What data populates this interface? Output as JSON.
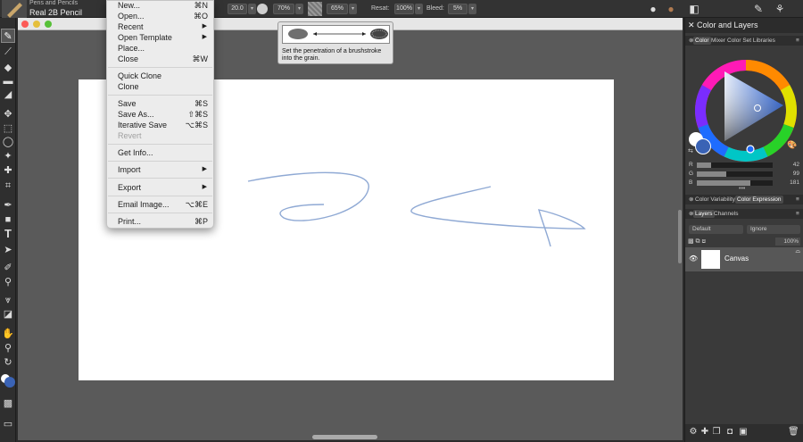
{
  "property_bar": {
    "brush_category": "Pens and Pencils",
    "brush_variant": "Real 2B Pencil",
    "size_value": "20.0",
    "opacity_value": "70%",
    "grain_value": "65%",
    "resat_label": "Resat:",
    "resat_value": "100%",
    "bleed_label": "Bleed:",
    "bleed_value": "5%"
  },
  "file_menu": {
    "items": [
      {
        "label": "New...",
        "shortcut": "⌘N"
      },
      {
        "label": "Open...",
        "shortcut": "⌘O"
      },
      {
        "label": "Recent",
        "submenu": true
      },
      {
        "label": "Open Template",
        "submenu": true
      },
      {
        "label": "Place..."
      },
      {
        "label": "Close",
        "shortcut": "⌘W"
      },
      {
        "label": "Quick Clone"
      },
      {
        "label": "Clone"
      },
      {
        "label": "Save",
        "shortcut": "⌘S"
      },
      {
        "label": "Save As...",
        "shortcut": "⇧⌘S"
      },
      {
        "label": "Iterative Save",
        "shortcut": "⌥⌘S"
      },
      {
        "label": "Revert",
        "disabled": true
      },
      {
        "label": "Get Info..."
      },
      {
        "label": "Import",
        "submenu": true
      },
      {
        "label": "Export",
        "submenu": true
      },
      {
        "label": "Email Image...",
        "shortcut": "⌥⌘E"
      },
      {
        "label": "Print...",
        "shortcut": "⌘P"
      }
    ],
    "submenu_arrow": "▶"
  },
  "tooltip": {
    "text": "Set the penetration of a brushstroke into the grain."
  },
  "color_panel": {
    "title": "Color and Layers",
    "tabs": [
      "Color",
      "Mixer",
      "Color Set Libraries"
    ],
    "main_color": "#3a63b5",
    "secondary_color": "#ffffff",
    "rgb": [
      {
        "channel": "R",
        "value": "42"
      },
      {
        "channel": "G",
        "value": "99"
      },
      {
        "channel": "B",
        "value": "181"
      }
    ],
    "sub_tabs": [
      "Color Variability",
      "Color Expression"
    ]
  },
  "layers_panel": {
    "tabs": [
      "Layers",
      "Channels"
    ],
    "composite_method": "Default",
    "composite_depth": "Ignore",
    "opacity_value": "100%",
    "layers": [
      {
        "name": "Canvas",
        "visible": true
      }
    ]
  },
  "stroke_color": "#8fa9d4"
}
